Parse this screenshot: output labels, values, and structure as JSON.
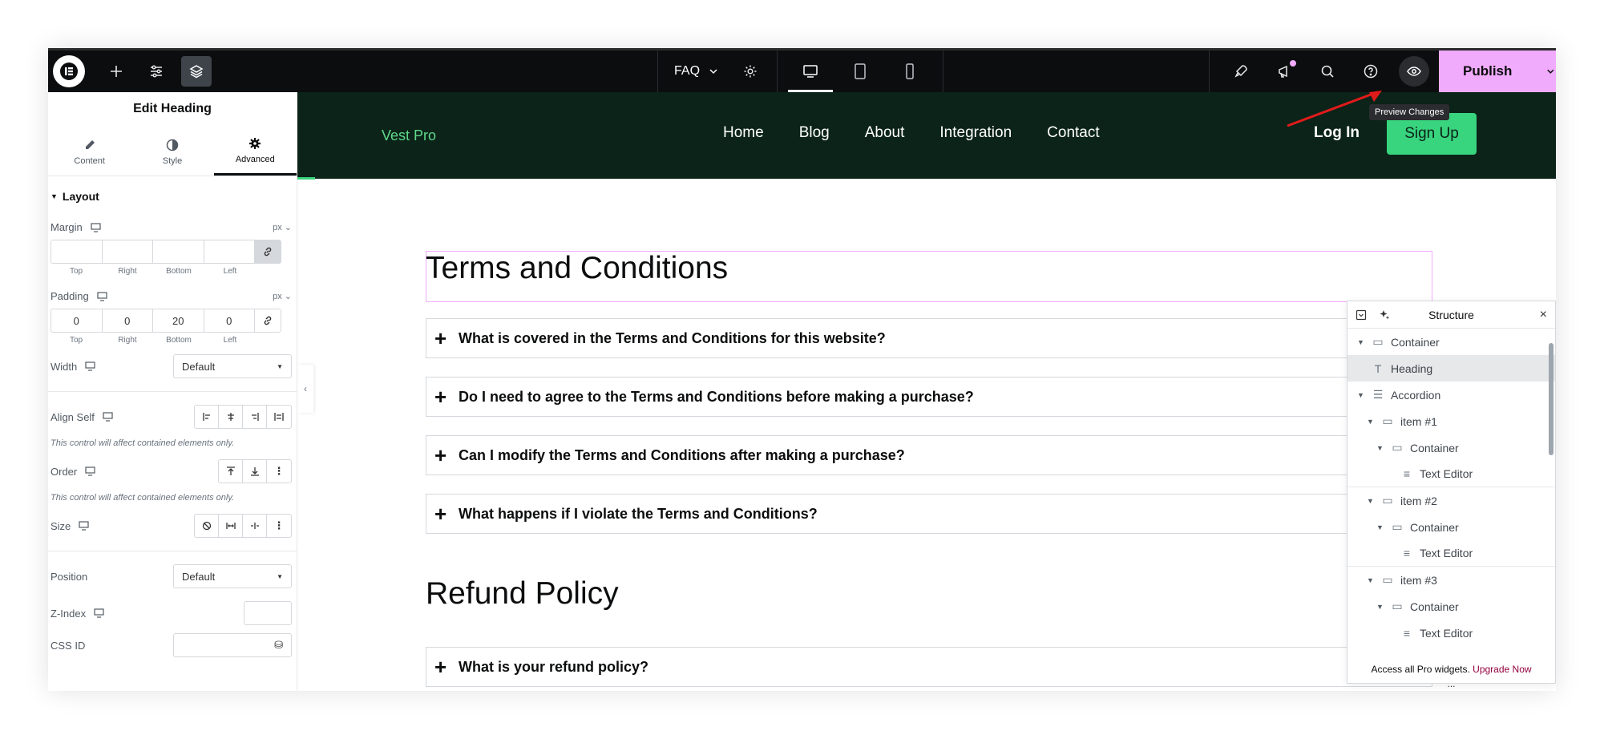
{
  "topbar": {
    "page_name": "FAQ",
    "publish_label": "Publish",
    "tooltip": "Preview Changes",
    "icons": [
      "elementor-logo-icon",
      "add-icon",
      "sliders-icon",
      "layers-icon",
      "settings-icon",
      "desktop-icon",
      "tablet-icon",
      "mobile-icon",
      "rocket-icon",
      "megaphone-icon",
      "search-icon",
      "help-icon",
      "eye-icon",
      "chevron-down-icon"
    ],
    "accent": "#f0abfc"
  },
  "panel": {
    "title": "Edit Heading",
    "tabs": [
      {
        "label": "Content",
        "icon": "pencil-icon"
      },
      {
        "label": "Style",
        "icon": "contrast-icon"
      },
      {
        "label": "Advanced",
        "icon": "gear-icon"
      }
    ],
    "section": "Layout",
    "margin": {
      "label": "Margin",
      "unit": "px",
      "values": [
        "",
        "",
        "",
        ""
      ],
      "sublabels": [
        "Top",
        "Right",
        "Bottom",
        "Left"
      ]
    },
    "padding": {
      "label": "Padding",
      "unit": "px",
      "values": [
        "0",
        "0",
        "20",
        "0"
      ],
      "sublabels": [
        "Top",
        "Right",
        "Bottom",
        "Left"
      ]
    },
    "width": {
      "label": "Width",
      "value": "Default"
    },
    "align_self": {
      "label": "Align Self",
      "note": "This control will affect contained elements only."
    },
    "order": {
      "label": "Order",
      "note": "This control will affect contained elements only."
    },
    "size": {
      "label": "Size"
    },
    "position": {
      "label": "Position",
      "value": "Default"
    },
    "zindex": {
      "label": "Z-Index"
    },
    "cssid": {
      "label": "CSS ID"
    }
  },
  "site": {
    "brand": "Vest Pro",
    "nav": [
      "Home",
      "Blog",
      "About",
      "Integration",
      "Contact"
    ],
    "login": "Log In",
    "signup": "Sign Up",
    "header_bg": "#0b2318",
    "accent": "#38d47e"
  },
  "content": {
    "heading1": "Terms and Conditions",
    "faq1": [
      "What is covered in the Terms and Conditions for this website?",
      "Do I need to agree to the Terms and Conditions before making a purchase?",
      "Can I modify the Terms and Conditions after making a purchase?",
      "What happens if I violate the Terms and Conditions?"
    ],
    "heading2": "Refund Policy",
    "faq2": [
      "What is your refund policy?"
    ]
  },
  "structure": {
    "title": "Structure",
    "items": [
      {
        "label": "Container",
        "level": 0,
        "caret": true
      },
      {
        "label": "Heading",
        "level": 1,
        "caret": false,
        "selected": true
      },
      {
        "label": "Accordion",
        "level": 1,
        "caret": true
      },
      {
        "label": "item #1",
        "level": 2,
        "caret": true
      },
      {
        "label": "Container",
        "level": 3,
        "caret": true
      },
      {
        "label": "Text Editor",
        "level": 4,
        "caret": false
      },
      {
        "label": "item #2",
        "level": 2,
        "caret": true
      },
      {
        "label": "Container",
        "level": 3,
        "caret": true
      },
      {
        "label": "Text Editor",
        "level": 4,
        "caret": false
      },
      {
        "label": "item #3",
        "level": 2,
        "caret": true
      },
      {
        "label": "Container",
        "level": 3,
        "caret": true
      },
      {
        "label": "Text Editor",
        "level": 4,
        "caret": false
      }
    ],
    "footer_text": "Access all Pro widgets.",
    "footer_link": "Upgrade Now",
    "more": "..."
  }
}
